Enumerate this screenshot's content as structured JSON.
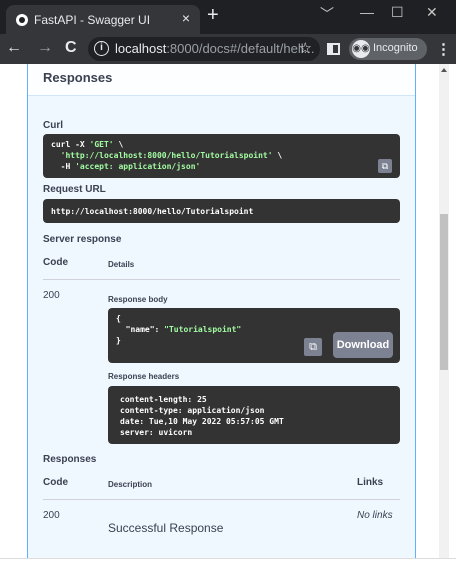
{
  "browser": {
    "tab_title": "FastAPI - Swagger UI",
    "tab_close": "×",
    "new_tab": "+",
    "minimize": "﹀",
    "win_min": "—",
    "win_max": "☐",
    "win_close": "✕",
    "back": "←",
    "forward": "→",
    "reload": "C",
    "info_glyph": "i",
    "url_host": "localhost",
    "url_path": ":8000/docs#/default/hell...",
    "star": "☆",
    "incognito_label": "Incognito",
    "incognito_glyph": "◉◉",
    "menu": "⋮"
  },
  "responses_section": {
    "title": "Responses"
  },
  "curl": {
    "label": "Curl",
    "line1_prefix": "curl -X ",
    "line1_method": "'GET'",
    "line1_suffix": " \\",
    "line2_indent": "  ",
    "line2_url": "'http://localhost:8000/hello/Tutorialspoint'",
    "line2_suffix": " \\",
    "line3_prefix": "  -H ",
    "line3_header": "'accept: application/json'"
  },
  "request_url": {
    "label": "Request URL",
    "value": "http://localhost:8000/hello/Tutorialspoint"
  },
  "server_response": {
    "label": "Server response",
    "code_header": "Code",
    "details_header": "Details",
    "code": "200",
    "body_label": "Response body",
    "body_open": "{",
    "body_key": "  \"name\": ",
    "body_value": "\"Tutorialspoint\"",
    "body_close": "}",
    "download_label": "Download",
    "headers_label": "Response headers",
    "headers_text": "content-length: 25\ncontent-type: application/json\ndate: Tue,10 May 2022 05:57:05 GMT\nserver: uvicorn"
  },
  "responses_table": {
    "label": "Responses",
    "code_header": "Code",
    "description_header": "Description",
    "links_header": "Links",
    "code": "200",
    "description": "Successful Response",
    "links": "No links"
  },
  "colors": {
    "tabbar_bg": "#1f2023",
    "toolbar_bg": "#35363a",
    "get_border": "#61affe",
    "get_bg": "#eff7ff",
    "code_bg": "#333333",
    "string_green": "#a2fca2"
  }
}
